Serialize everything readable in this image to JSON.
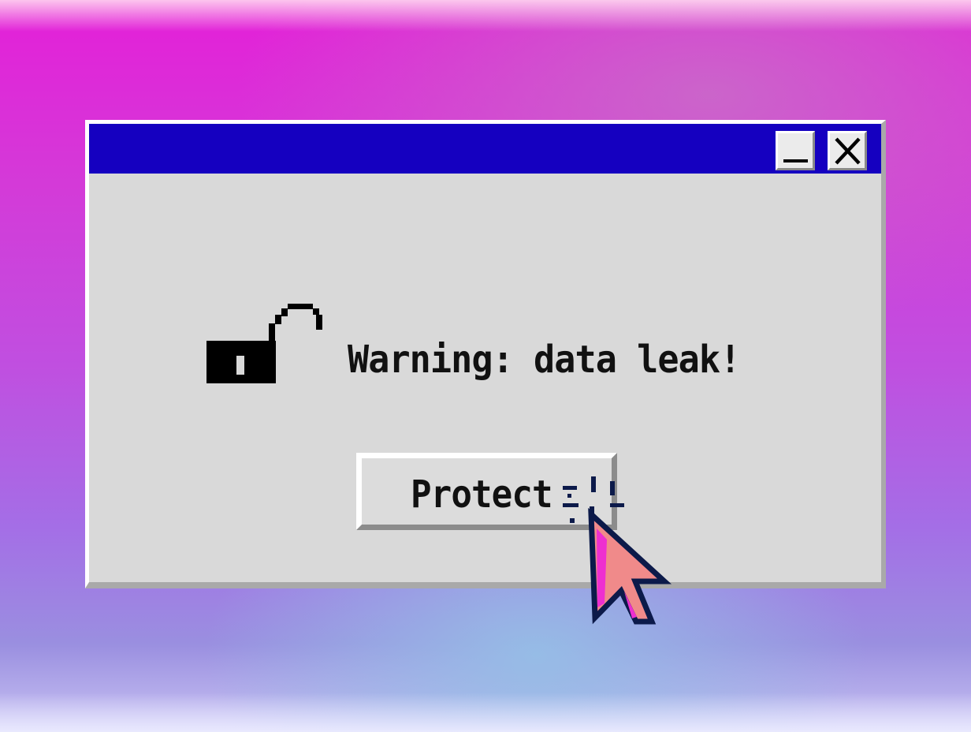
{
  "dialog": {
    "title": "",
    "message": "Warning: data leak!",
    "primary_button_label": "Protect"
  },
  "titlebar": {
    "minimize_icon": "minimize-icon",
    "close_icon": "close-icon",
    "color": "#1500c0"
  },
  "icons": {
    "message_icon": "unlocked-padlock-icon",
    "pointer": "arrow-cursor-icon"
  },
  "colors": {
    "window_face": "#d9d9d9",
    "background_top": "#e41fd8",
    "background_bottom": "#9a8fe0",
    "cursor_fill": "#f08a8a",
    "cursor_outline": "#0c1a4a"
  }
}
